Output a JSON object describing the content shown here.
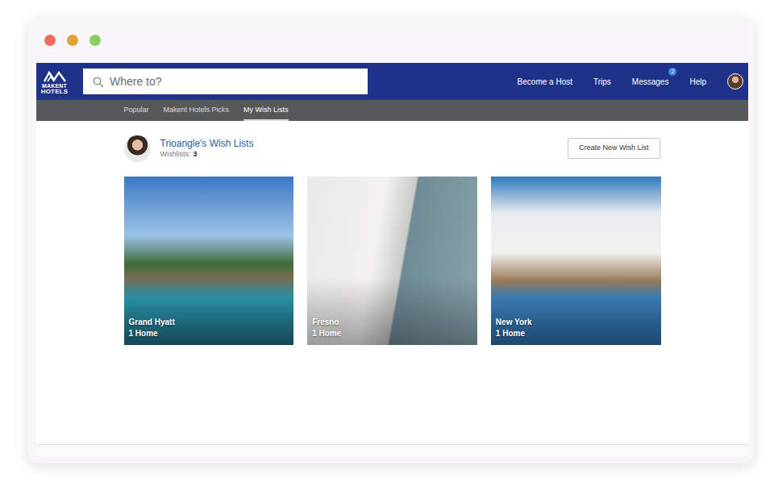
{
  "logo": {
    "line1": "MAKENT",
    "line2": "HOTELS"
  },
  "search": {
    "placeholder": "Where to?"
  },
  "nav": [
    {
      "label": "Become a Host"
    },
    {
      "label": "Trips"
    },
    {
      "label": "Messages",
      "badge": "2"
    },
    {
      "label": "Help"
    }
  ],
  "tabs": [
    {
      "label": "Popular",
      "selected": false
    },
    {
      "label": "Makent Hotels Picks",
      "selected": false
    },
    {
      "label": "My Wish Lists",
      "selected": true
    }
  ],
  "profile": {
    "title": "Trioangle's Wish Lists",
    "count_label": "Wishlists:",
    "count": "3"
  },
  "create_button": "Create New Wish List",
  "wishlists": [
    {
      "name": "Grand Hyatt",
      "homes": "1 Home"
    },
    {
      "name": "Fresno",
      "homes": "1 Home"
    },
    {
      "name": "New York",
      "homes": "1 Home"
    }
  ]
}
